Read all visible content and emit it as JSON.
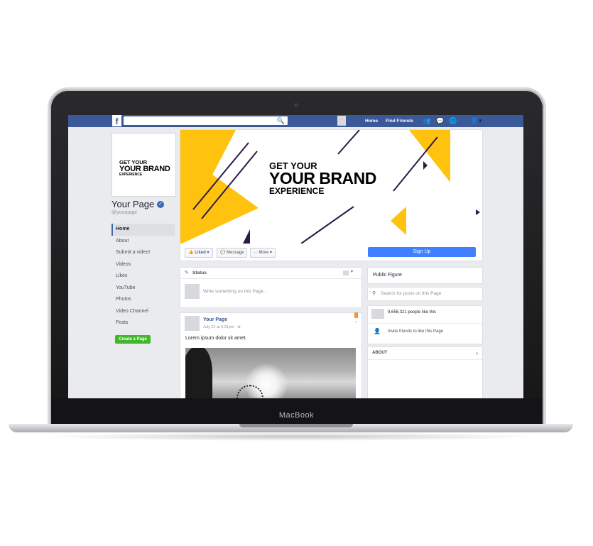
{
  "device": {
    "brand_label": "MacBook"
  },
  "topbar": {
    "logo": "f",
    "search_placeholder": "",
    "search_icon": "🔍",
    "links": {
      "home": "Home",
      "find_friends": "Find Friends"
    },
    "icons": {
      "friends": "👥",
      "messages": "💬",
      "notifications": "🌐",
      "settings": "▾"
    }
  },
  "profile": {
    "image_lines": [
      "GET YOUR",
      "YOUR BRAND",
      "EXPERIENCE"
    ],
    "name": "Your Page",
    "verified": "✓",
    "handle": "@yourpage"
  },
  "sidebar": {
    "items": [
      {
        "label": "Home",
        "active": true
      },
      {
        "label": "About"
      },
      {
        "label": "Submit a video!"
      },
      {
        "label": "Videos"
      },
      {
        "label": "Likes"
      },
      {
        "label": "YouTube"
      },
      {
        "label": "Photos"
      },
      {
        "label": "Video Channel"
      },
      {
        "label": "Posts"
      }
    ],
    "create_page": "Create a Page"
  },
  "cover": {
    "lines": [
      "GET YOUR",
      "YOUR BRAND",
      "EXPERIENCE"
    ],
    "colors": {
      "yellow": "#FFC20E",
      "purple": "#2E1A47"
    }
  },
  "actions": {
    "liked": "👍 Liked ▾",
    "message": "💬 Message",
    "more": "··· More ▾",
    "sign_up": "Sign Up"
  },
  "status": {
    "label": "Status",
    "placeholder": "Write something on this Page..."
  },
  "post": {
    "author": "Your Page",
    "meta": "July 22 at 6:31pm · ⊕",
    "text": "Lorem ipsum dolor sit amet."
  },
  "right": {
    "category": "Public Figure",
    "search_placeholder": "Search for posts on this Page",
    "likes_count": "9,658,321 people like this",
    "invite": "Invite friends to like this Page",
    "about_label": "ABOUT",
    "about_chevron": "›"
  }
}
